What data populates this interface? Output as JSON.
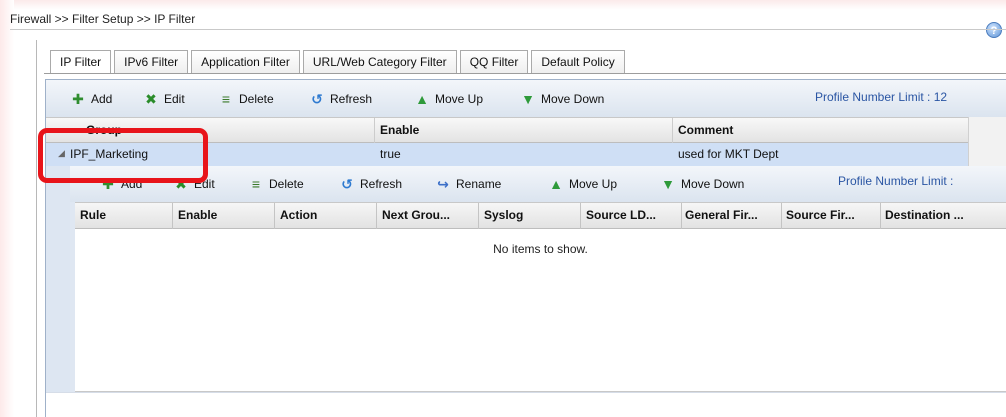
{
  "breadcrumb": "Firewall >> Filter Setup >> IP Filter",
  "help_icon": "?",
  "tabs": [
    {
      "label": "IP Filter",
      "active": true
    },
    {
      "label": "IPv6 Filter"
    },
    {
      "label": "Application Filter"
    },
    {
      "label": "URL/Web Category Filter"
    },
    {
      "label": "QQ Filter"
    },
    {
      "label": "Default Policy"
    }
  ],
  "toolbar": {
    "add": "Add",
    "edit": "Edit",
    "delete": "Delete",
    "refresh": "Refresh",
    "move_up": "Move Up",
    "move_down": "Move Down",
    "limit": "Profile Number Limit : 12"
  },
  "group_table": {
    "columns": [
      "Group",
      "Enable",
      "Comment"
    ],
    "rows": [
      {
        "group": "IPF_Marketing",
        "enable": "true",
        "comment": "used for MKT Dept"
      }
    ]
  },
  "inner_toolbar": {
    "add": "Add",
    "edit": "Edit",
    "delete": "Delete",
    "refresh": "Refresh",
    "rename": "Rename",
    "move_up": "Move Up",
    "move_down": "Move Down",
    "limit": "Profile Number Limit :"
  },
  "rule_table": {
    "columns": [
      "Rule",
      "Enable",
      "Action",
      "Next Grou...",
      "Syslog",
      "Source LD...",
      "General Fir...",
      "Source Fir...",
      "Destination ..."
    ],
    "empty_text": "No items to show."
  },
  "colors": {
    "highlight": "#e8141a",
    "selected_row": "#cfdff5",
    "limit_text": "#2a55a3"
  }
}
